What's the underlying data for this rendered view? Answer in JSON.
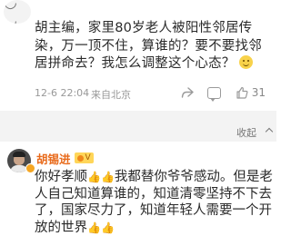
{
  "top_comment": {
    "avatar_glyph": "◡ ◡",
    "text": "胡主编，家里80岁老人被阳性邻居传染，万一顶不住，算谁的？要不要找邻居拼命去？我怎么调整这个心态？",
    "emoji": "smile-emoji",
    "time": "12-6 22:04",
    "location": "来自北京",
    "likes": "31"
  },
  "collapse": {
    "label": "收起"
  },
  "reply": {
    "name": "胡锡进",
    "badge": "V",
    "text_parts": [
      "你好孝顺",
      "我都替你爷爷感动。但是老人自己知道算谁的，知道清零坚持不下去了，国家尽力了，知道年轻人需要一个开放的世界"
    ],
    "emoji_thumbs": "👍👍"
  },
  "colors": {
    "accent_name": "#e86a1b",
    "divider_bg": "#f3f3f3",
    "meta": "#999999"
  }
}
